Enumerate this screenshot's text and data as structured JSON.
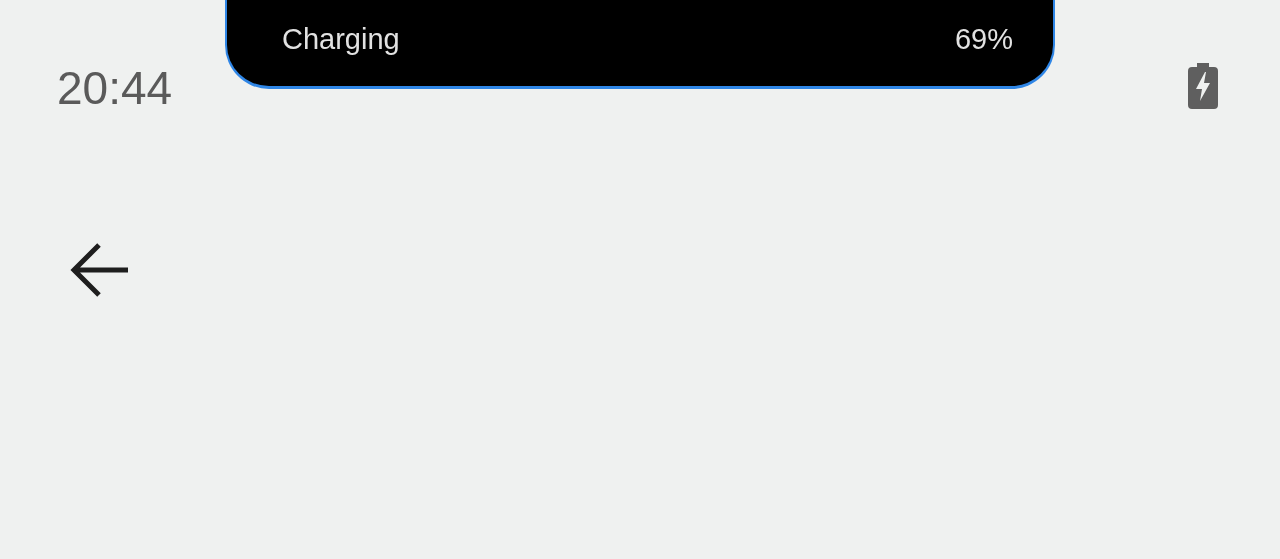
{
  "notch_banner": {
    "status": "Charging",
    "percent": "69%"
  },
  "status_bar": {
    "time": "20:44"
  }
}
